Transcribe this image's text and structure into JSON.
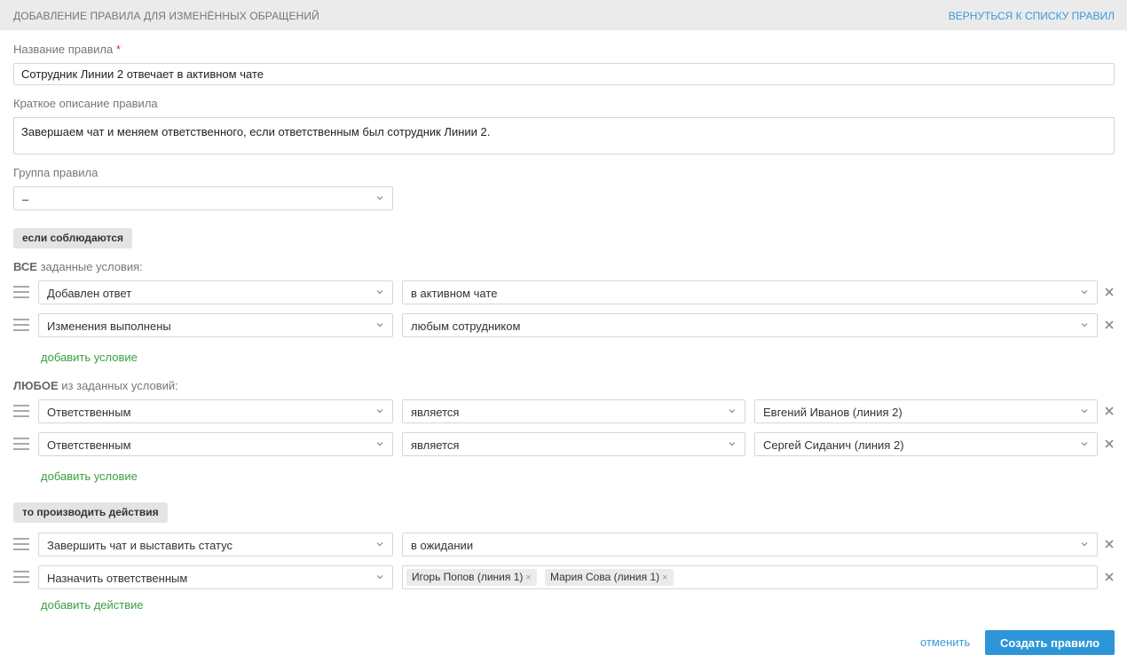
{
  "header": {
    "title": "Добавление правила для изменённых обращений",
    "back_link": "Вернуться к списку правил"
  },
  "form": {
    "name_label": "Название правила",
    "required_mark": "*",
    "name_value": "Сотрудник Линии 2 отвечает в активном чате",
    "description_label": "Краткое описание правила",
    "description_value": "Завершаем чат и меняем ответственного, если ответственным был сотрудник Линии 2.",
    "group_label": "Группа правила",
    "group_value": "–"
  },
  "conditions": {
    "badge": "если соблюдаются",
    "all_prefix": "ВСЕ",
    "all_suffix": " заданные условия:",
    "all_rows": [
      {
        "field": "Добавлен ответ",
        "value": "в активном чате"
      },
      {
        "field": "Изменения выполнены",
        "value": "любым сотрудником"
      }
    ],
    "add_condition_label": "добавить условие",
    "any_prefix": "ЛЮБОЕ",
    "any_suffix": " из заданных условий:",
    "any_rows": [
      {
        "field": "Ответственным",
        "operator": "является",
        "value": "Евгений Иванов (линия 2)"
      },
      {
        "field": "Ответственным",
        "operator": "является",
        "value": "Сергей Сиданич (линия 2)"
      }
    ]
  },
  "actions": {
    "badge": "то производить действия",
    "rows": [
      {
        "field": "Завершить чат и выставить статус",
        "value": "в ожидании"
      },
      {
        "field": "Назначить ответственным",
        "tags": [
          "Игорь Попов (линия 1)",
          "Мария Сова (линия 1)"
        ]
      }
    ],
    "add_action_label": "добавить действие"
  },
  "footer": {
    "cancel_label": "отменить",
    "create_label": "Создать правило"
  },
  "icons": {
    "chevron": "chevron-down-icon",
    "remove": "close-icon",
    "drag": "drag-handle-icon",
    "tag_remove": "×"
  },
  "colors": {
    "accent": "#2e96d8",
    "link": "#3b9ad9",
    "add_link": "#3aa040",
    "required": "#e0392b"
  }
}
